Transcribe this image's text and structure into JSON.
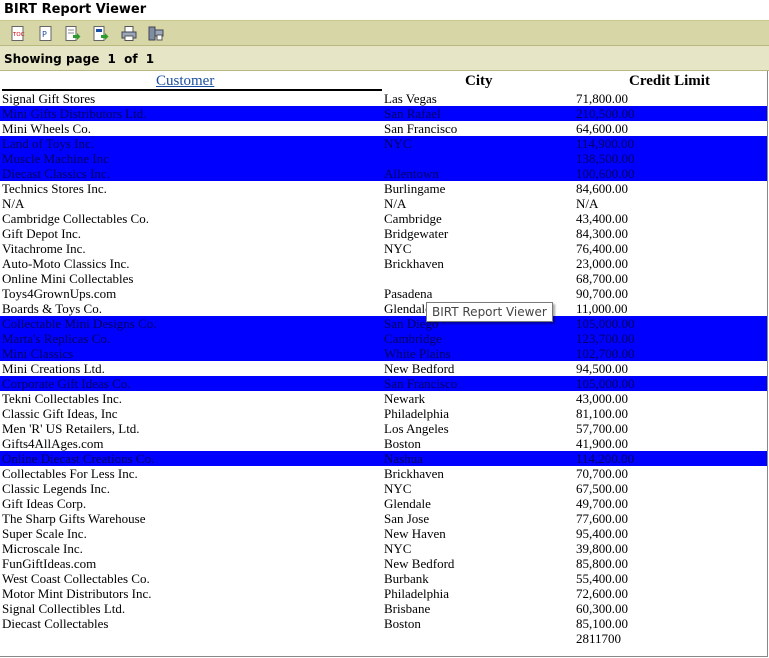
{
  "window": {
    "title": "BIRT Report Viewer"
  },
  "toolbar": {
    "buttons": [
      {
        "name": "toc",
        "label": "TOC"
      },
      {
        "name": "parameters",
        "label": "P"
      },
      {
        "name": "export-data",
        "label": ""
      },
      {
        "name": "export-report",
        "label": ""
      },
      {
        "name": "print",
        "label": ""
      },
      {
        "name": "print-server",
        "label": ""
      }
    ]
  },
  "pager": {
    "showing": "Showing page",
    "current": "1",
    "of": "of",
    "total": "1"
  },
  "report": {
    "headers": {
      "customer": "Customer",
      "city": "City",
      "credit": "Credit Limit"
    },
    "highlight_color": "#0000ff",
    "rows": [
      {
        "customer": "Signal Gift Stores",
        "city": "Las Vegas",
        "credit": "71,800.00",
        "hl": false
      },
      {
        "customer": "Mini Gifts Distributors Ltd.",
        "city": "San Rafael",
        "credit": "210,500.00",
        "hl": true
      },
      {
        "customer": "Mini Wheels Co.",
        "city": "San Francisco",
        "credit": "64,600.00",
        "hl": false
      },
      {
        "customer": "Land of Toys Inc.",
        "city": "NYC",
        "credit": "114,900.00",
        "hl": true
      },
      {
        "customer": "Muscle Machine Inc",
        "city": "",
        "credit": "138,500.00",
        "hl": true
      },
      {
        "customer": "Diecast Classics Inc.",
        "city": "Allentown",
        "credit": "100,600.00",
        "hl": true
      },
      {
        "customer": "Technics Stores Inc.",
        "city": "Burlingame",
        "credit": "84,600.00",
        "hl": false
      },
      {
        "customer": "N/A",
        "city": "N/A",
        "credit": "N/A",
        "hl": false
      },
      {
        "customer": "Cambridge Collectables Co.",
        "city": "Cambridge",
        "credit": "43,400.00",
        "hl": false
      },
      {
        "customer": "Gift Depot Inc.",
        "city": "Bridgewater",
        "credit": "84,300.00",
        "hl": false
      },
      {
        "customer": "Vitachrome Inc.",
        "city": "NYC",
        "credit": "76,400.00",
        "hl": false
      },
      {
        "customer": "Auto-Moto Classics Inc.",
        "city": "Brickhaven",
        "credit": "23,000.00",
        "hl": false
      },
      {
        "customer": "Online Mini Collectables",
        "city": "",
        "credit": "68,700.00",
        "hl": false
      },
      {
        "customer": "Toys4GrownUps.com",
        "city": "Pasadena",
        "credit": "90,700.00",
        "hl": false
      },
      {
        "customer": "Boards & Toys Co.",
        "city": "Glendale",
        "credit": "11,000.00",
        "hl": false
      },
      {
        "customer": "Collectable Mini Designs Co.",
        "city": "San Diego",
        "credit": "105,000.00",
        "hl": true
      },
      {
        "customer": "Marta's Replicas Co.",
        "city": "Cambridge",
        "credit": "123,700.00",
        "hl": true
      },
      {
        "customer": "Mini Classics",
        "city": "White Plains",
        "credit": "102,700.00",
        "hl": true
      },
      {
        "customer": "Mini Creations Ltd.",
        "city": "New Bedford",
        "credit": "94,500.00",
        "hl": false
      },
      {
        "customer": "Corporate Gift Ideas Co.",
        "city": "San Francisco",
        "credit": "105,000.00",
        "hl": true
      },
      {
        "customer": "Tekni Collectables Inc.",
        "city": "Newark",
        "credit": "43,000.00",
        "hl": false
      },
      {
        "customer": "Classic Gift Ideas, Inc",
        "city": "Philadelphia",
        "credit": "81,100.00",
        "hl": false
      },
      {
        "customer": "Men 'R' US Retailers, Ltd.",
        "city": "Los Angeles",
        "credit": "57,700.00",
        "hl": false
      },
      {
        "customer": "Gifts4AllAges.com",
        "city": "Boston",
        "credit": "41,900.00",
        "hl": false
      },
      {
        "customer": "Online Diecast Creations Co.",
        "city": "Nashua",
        "credit": "114,200.00",
        "hl": true
      },
      {
        "customer": "Collectables For Less Inc.",
        "city": "Brickhaven",
        "credit": "70,700.00",
        "hl": false
      },
      {
        "customer": "Classic Legends Inc.",
        "city": "NYC",
        "credit": "67,500.00",
        "hl": false
      },
      {
        "customer": "Gift Ideas Corp.",
        "city": "Glendale",
        "credit": "49,700.00",
        "hl": false
      },
      {
        "customer": "The Sharp Gifts Warehouse",
        "city": "San Jose",
        "credit": "77,600.00",
        "hl": false
      },
      {
        "customer": "Super Scale Inc.",
        "city": "New Haven",
        "credit": "95,400.00",
        "hl": false
      },
      {
        "customer": "Microscale Inc.",
        "city": "NYC",
        "credit": "39,800.00",
        "hl": false
      },
      {
        "customer": "FunGiftIdeas.com",
        "city": "New Bedford",
        "credit": "85,800.00",
        "hl": false
      },
      {
        "customer": "West Coast Collectables Co.",
        "city": "Burbank",
        "credit": "55,400.00",
        "hl": false
      },
      {
        "customer": "Motor Mint Distributors Inc.",
        "city": "Philadelphia",
        "credit": "72,600.00",
        "hl": false
      },
      {
        "customer": "Signal Collectibles Ltd.",
        "city": "Brisbane",
        "credit": "60,300.00",
        "hl": false
      },
      {
        "customer": "Diecast Collectables",
        "city": "Boston",
        "credit": "85,100.00",
        "hl": false
      }
    ],
    "total": "2811700"
  },
  "tooltip": {
    "text": "BIRT Report Viewer"
  }
}
